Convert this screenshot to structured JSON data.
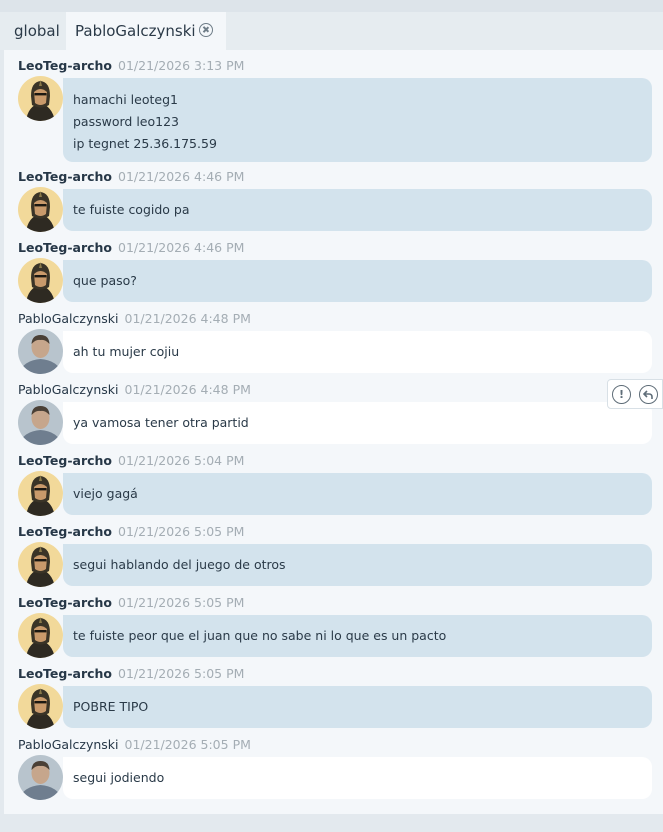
{
  "tabs": [
    {
      "label": "global"
    },
    {
      "label": "PabloGalczynski"
    }
  ],
  "messages": [
    {
      "author": "LeoTeg-archo",
      "timestamp": "01/21/2026 3:13 PM",
      "lines": [
        "hamachi leoteg1",
        "password leo123",
        "ip tegnet 25.36.175.59"
      ]
    },
    {
      "author": "LeoTeg-archo",
      "timestamp": "01/21/2026 4:46 PM",
      "lines": [
        "te fuiste cogido pa"
      ]
    },
    {
      "author": "LeoTeg-archo",
      "timestamp": "01/21/2026 4:46 PM",
      "lines": [
        "que paso?"
      ]
    },
    {
      "author": "PabloGalczynski",
      "timestamp": "01/21/2026 4:48 PM",
      "lines": [
        "ah tu mujer cojiu"
      ]
    },
    {
      "author": "PabloGalczynski",
      "timestamp": "01/21/2026 4:48 PM",
      "lines": [
        "ya vamosa tener otra partid"
      ]
    },
    {
      "author": "LeoTeg-archo",
      "timestamp": "01/21/2026 5:04 PM",
      "lines": [
        "viejo gagá"
      ]
    },
    {
      "author": "LeoTeg-archo",
      "timestamp": "01/21/2026 5:05 PM",
      "lines": [
        "segui hablando del juego de otros"
      ]
    },
    {
      "author": "LeoTeg-archo",
      "timestamp": "01/21/2026 5:05 PM",
      "lines": [
        "te fuiste peor que el juan que no sabe ni lo que es un pacto"
      ]
    },
    {
      "author": "LeoTeg-archo",
      "timestamp": "01/21/2026 5:05 PM",
      "lines": [
        "POBRE TIPO"
      ]
    },
    {
      "author": "PabloGalczynski",
      "timestamp": "01/21/2026 5:05 PM",
      "lines": [
        "segui jodiendo"
      ]
    }
  ],
  "message_actions": {
    "report_icon": "exclamation-circle-icon",
    "reply_icon": "reply-arrow-icon"
  },
  "colors": {
    "own_bubble": "#d3e3ed",
    "other_bubble": "#ffffff",
    "timestamp": "#a4adb4",
    "panel": "#f4f7fa"
  }
}
